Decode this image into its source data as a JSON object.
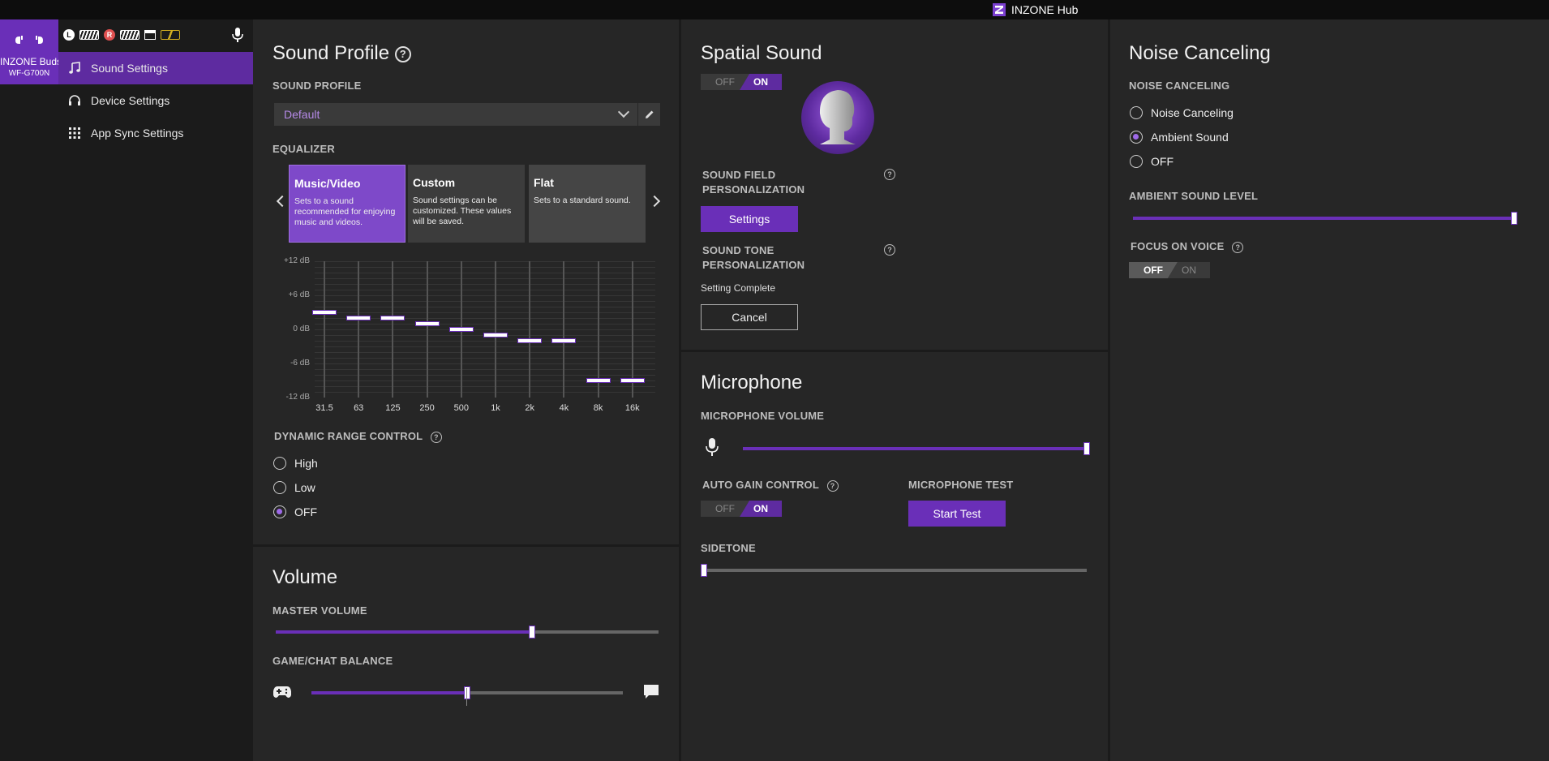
{
  "window": {
    "title": "INZONE Hub"
  },
  "device": {
    "name": "INZONE Buds",
    "model": "WF-G700N"
  },
  "nav": {
    "items": [
      {
        "label": "Sound Settings",
        "icon": "music-note-icon"
      },
      {
        "label": "Device Settings",
        "icon": "headphones-icon"
      },
      {
        "label": "App Sync Settings",
        "icon": "grid-icon"
      }
    ]
  },
  "status": {
    "icons": [
      "clock-icon",
      "battery-left-icon",
      "r-badge-icon",
      "battery-right-icon",
      "case-icon",
      "battery-case-icon"
    ],
    "r_badge": "R",
    "clock": "L"
  },
  "sound_profile": {
    "title": "Sound Profile",
    "profile_label": "SOUND PROFILE",
    "profile_value": "Default",
    "equalizer_label": "EQUALIZER",
    "presets": [
      {
        "name": "Music/Video",
        "desc": "Sets to a sound recommended for enjoying music and videos."
      },
      {
        "name": "Custom",
        "desc": "Sound settings can be customized. These values will be saved."
      },
      {
        "name": "Flat",
        "desc": "Sets to a standard sound."
      }
    ],
    "selected_preset": "Music/Video",
    "eq": {
      "y_ticks": [
        "+12 dB",
        "+6 dB",
        "0 dB",
        "-6 dB",
        "-12 dB"
      ],
      "ylim": [
        -12,
        12
      ],
      "bands": [
        "31.5",
        "63",
        "125",
        "250",
        "500",
        "1k",
        "2k",
        "4k",
        "8k",
        "16k"
      ],
      "values": [
        3,
        2,
        2,
        1,
        0,
        -1,
        -2,
        -2,
        -9,
        -9
      ]
    },
    "drc_label": "DYNAMIC RANGE CONTROL",
    "drc_options": [
      "High",
      "Low",
      "OFF"
    ],
    "drc_selected": "OFF"
  },
  "volume": {
    "title": "Volume",
    "master_label": "MASTER VOLUME",
    "master_value": 0.67,
    "balance_label": "GAME/CHAT BALANCE",
    "balance_value": 0.5
  },
  "spatial": {
    "title": "Spatial Sound",
    "toggle_off": "OFF",
    "toggle_on": "ON",
    "state": "ON",
    "field_label_1": "SOUND FIELD",
    "field_label_2": "PERSONALIZATION",
    "settings_btn": "Settings",
    "tone_label_1": "SOUND TONE",
    "tone_label_2": "PERSONALIZATION",
    "tone_status": "Setting Complete",
    "cancel_btn": "Cancel"
  },
  "microphone": {
    "title": "Microphone",
    "volume_label": "MICROPHONE VOLUME",
    "volume_value": 1.0,
    "agc_label": "AUTO GAIN CONTROL",
    "agc_off": "OFF",
    "agc_on": "ON",
    "agc_state": "ON",
    "test_label": "MICROPHONE TEST",
    "test_btn": "Start Test",
    "sidetone_label": "SIDETONE",
    "sidetone_value": 0.0
  },
  "noise": {
    "title": "Noise Canceling",
    "label": "NOISE CANCELING",
    "options": [
      "Noise Canceling",
      "Ambient Sound",
      "OFF"
    ],
    "selected": "Ambient Sound",
    "ambient_label": "AMBIENT SOUND LEVEL",
    "ambient_value": 1.0,
    "focus_label": "FOCUS ON VOICE",
    "focus_off": "OFF",
    "focus_on": "ON",
    "focus_state": "OFF"
  },
  "colors": {
    "accent": "#6a2fb8",
    "bg": "#1b1b1b",
    "panel": "#262626"
  }
}
